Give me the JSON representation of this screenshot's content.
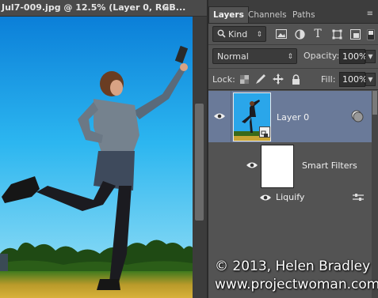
{
  "document": {
    "tab_title": "Jul7-009.jpg @ 12.5% (Layer 0, RGB...",
    "close_glyph": "×"
  },
  "panel": {
    "tabs": [
      {
        "label": "Layers",
        "active": true
      },
      {
        "label": "Channels",
        "active": false
      },
      {
        "label": "Paths",
        "active": false
      }
    ],
    "menu_glyph": "≡",
    "filter": {
      "kind_label": "Kind",
      "icons": [
        "image-filter-icon",
        "adjustment-filter-icon",
        "type-filter-icon",
        "shape-filter-icon",
        "smart-object-filter-icon"
      ]
    },
    "blend_mode": "Normal",
    "opacity_label": "Opacity:",
    "opacity_value": "100%",
    "lock_label": "Lock:",
    "lock_icons": [
      "lock-transparent-icon",
      "lock-image-icon",
      "lock-position-icon",
      "lock-all-icon"
    ],
    "fill_label": "Fill:",
    "fill_value": "100%"
  },
  "layers": [
    {
      "name": "Layer 0",
      "selected": true,
      "visible": true
    },
    {
      "name": "Smart Filters",
      "visible": true
    },
    {
      "name": "Liquify",
      "visible": true
    }
  ],
  "watermark": {
    "line1": "© 2013, Helen Bradley",
    "line2": "www.projectwoman.com"
  },
  "colors": {
    "selected_layer": "#6a7a99",
    "panel_bg": "#535353",
    "sky": "#1aa3e8"
  }
}
